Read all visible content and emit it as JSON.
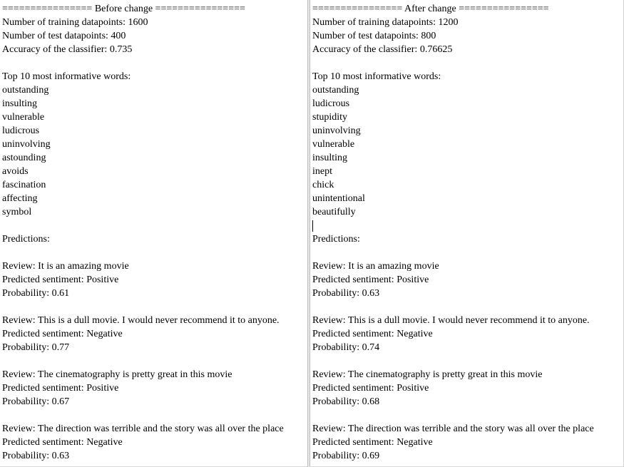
{
  "panes": {
    "left": {
      "header": "================ Before change ================",
      "train_text": "Number of training datapoints: 1600",
      "test_text": "Number of test datapoints: 400",
      "acc_text": "Accuracy of the classifier: 0.735",
      "words_heading": "Top 10 most informative words:",
      "words": [
        "outstanding",
        "insulting",
        "vulnerable",
        "ludicrous",
        "uninvolving",
        "astounding",
        "avoids",
        "fascination",
        "affecting",
        "symbol"
      ],
      "predictions_heading": "Predictions:",
      "predictions": [
        {
          "review": "Review: It is an amazing movie",
          "sentiment": "Predicted sentiment: Positive",
          "probability": "Probability: 0.61"
        },
        {
          "review": "Review: This is a dull movie. I would never recommend it to anyone.",
          "sentiment": "Predicted sentiment: Negative",
          "probability": "Probability: 0.77"
        },
        {
          "review": "Review: The cinematography is pretty great in this movie",
          "sentiment": "Predicted sentiment: Positive",
          "probability": "Probability: 0.67"
        },
        {
          "review": "Review: The direction was terrible and the story was all over the place",
          "sentiment": "Predicted sentiment: Negative",
          "probability": "Probability: 0.63"
        }
      ]
    },
    "right": {
      "header": "================ After change ================",
      "train_text": "Number of training datapoints: 1200",
      "test_text": "Number of test datapoints: 800",
      "acc_text": "Accuracy of the classifier: 0.76625",
      "words_heading": "Top 10 most informative words:",
      "words": [
        "outstanding",
        "ludicrous",
        "stupidity",
        "uninvolving",
        "vulnerable",
        "insulting",
        "inept",
        "chick",
        "unintentional",
        "beautifully"
      ],
      "predictions_heading": "Predictions:",
      "predictions": [
        {
          "review": "Review: It is an amazing movie",
          "sentiment": "Predicted sentiment: Positive",
          "probability": "Probability: 0.63"
        },
        {
          "review": "Review: This is a dull movie. I would never recommend it to anyone.",
          "sentiment": "Predicted sentiment: Negative",
          "probability": "Probability: 0.74"
        },
        {
          "review": "Review: The cinematography is pretty great in this movie",
          "sentiment": "Predicted sentiment: Positive",
          "probability": "Probability: 0.68"
        },
        {
          "review": "Review: The direction was terrible and the story was all over the place",
          "sentiment": "Predicted sentiment: Negative",
          "probability": "Probability: 0.69"
        }
      ]
    }
  }
}
